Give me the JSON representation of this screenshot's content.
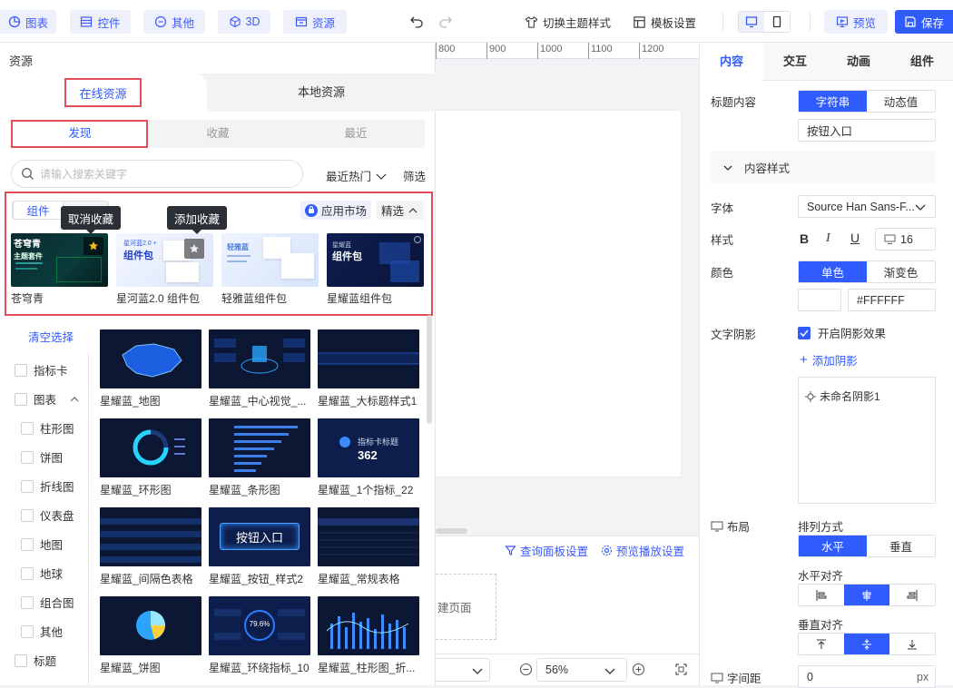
{
  "toolbar": {
    "chart": "图表",
    "control": "控件",
    "other": "其他",
    "three_d": "3D",
    "resource": "资源",
    "switch_theme": "切换主题样式",
    "template_settings": "模板设置",
    "preview": "预览",
    "save": "保存"
  },
  "ruler": {
    "ticks": [
      "800",
      "900",
      "1000",
      "1100",
      "1200"
    ]
  },
  "resources": {
    "title": "资源",
    "tab_online": "在线资源",
    "tab_local": "本地资源",
    "sub_tabs": [
      "发现",
      "收藏",
      "最近"
    ],
    "search_placeholder": "请输入搜索关键字",
    "sort": "最近热门",
    "filter": "筛选",
    "type_tab": "组件",
    "market": "应用市场",
    "featured": "精选",
    "tooltip_unfav": "取消收藏",
    "tooltip_fav": "添加收藏",
    "featured_cards": [
      "苍穹青",
      "星河蓝2.0 组件包",
      "轻雅蓝组件包",
      "星耀蓝组件包"
    ],
    "card_texts": {
      "c1_title": "苍穹青",
      "c1_sub": "主题套件",
      "c2_title": "星河蓝2.0 +",
      "c2_big": "组件包",
      "c3_title": "轻雅蓝",
      "c4_title": "星耀蓝",
      "c4_big": "组件包"
    },
    "clear_selection": "清空选择",
    "filters": [
      {
        "label": "指标卡",
        "indent": false,
        "caret": false
      },
      {
        "label": "图表",
        "indent": false,
        "caret": true
      },
      {
        "label": "柱形图",
        "indent": true,
        "caret": false
      },
      {
        "label": "饼图",
        "indent": true,
        "caret": false
      },
      {
        "label": "折线图",
        "indent": true,
        "caret": false
      },
      {
        "label": "仪表盘",
        "indent": true,
        "caret": false
      },
      {
        "label": "地图",
        "indent": true,
        "caret": false
      },
      {
        "label": "地球",
        "indent": true,
        "caret": false
      },
      {
        "label": "组合图",
        "indent": true,
        "caret": false
      },
      {
        "label": "其他",
        "indent": true,
        "caret": false
      },
      {
        "label": "标题",
        "indent": false,
        "caret": false
      }
    ],
    "grid": [
      "星耀蓝_地图",
      "星耀蓝_中心视觉_...",
      "星耀蓝_大标题样式1",
      "星耀蓝_环形图",
      "星耀蓝_条形图",
      "星耀蓝_1个指标_22",
      "星耀蓝_间隔色表格",
      "星耀蓝_按钮_样式2",
      "星耀蓝_常规表格",
      "星耀蓝_饼图",
      "星耀蓝_环绕指标_10",
      "星耀蓝_柱形图_折..."
    ],
    "thumb_texts": {
      "kpi_label": "指标卡标题",
      "kpi_value": "362",
      "button": "按钮入口",
      "ring_value": "79.6%"
    }
  },
  "canvas": {
    "query_panel": "查询面板设置",
    "preview_settings": "预览播放设置",
    "new_page": "建页面",
    "zoom": "56%"
  },
  "props": {
    "tabs": [
      "内容",
      "交互",
      "动画",
      "组件"
    ],
    "title_content_label": "标题内容",
    "seg_string": "字符串",
    "seg_dynamic": "动态值",
    "title_value": "按钮入口",
    "section_content_style": "内容样式",
    "font_label": "字体",
    "font_value": "Source Han Sans-F...",
    "style_label": "样式",
    "font_size": "16",
    "color_label": "颜色",
    "seg_solid": "单色",
    "seg_gradient": "渐变色",
    "color_value": "#FFFFFF",
    "shadow_label": "文字阴影",
    "shadow_enable": "开启阴影效果",
    "add_shadow": "添加阴影",
    "shadow_item": "未命名阴影1",
    "layout_label": "布局",
    "arrange_label": "排列方式",
    "seg_horizontal": "水平",
    "seg_vertical": "垂直",
    "h_align_label": "水平对齐",
    "v_align_label": "垂直对齐",
    "spacing_label": "字间距",
    "spacing_value": "0",
    "spacing_unit": "px"
  },
  "colors": {
    "accent": "#2f5bff",
    "highlight_box": "#e34d59",
    "tooltip": "#2b2f36"
  }
}
